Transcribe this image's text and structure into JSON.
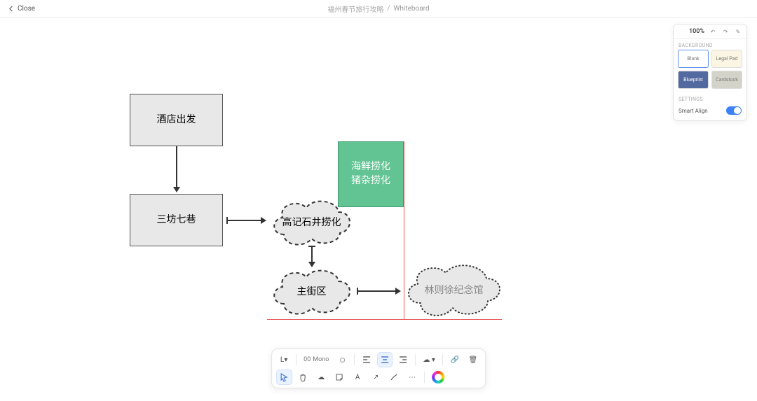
{
  "header": {
    "close": "Close",
    "doc_title": "福州春节旅行攻略",
    "page_name": "Whiteboard"
  },
  "shapes": {
    "hotel": "酒店出发",
    "sanfang": "三坊七巷",
    "seafood_line1": "海鲜捞化",
    "seafood_line2": "猪杂捞化",
    "gaoji": "高记石井捞化",
    "mainstreet": "主街区",
    "linzexu": "林则徐纪念馆"
  },
  "panel": {
    "zoom": "100%",
    "bg_label": "BACKGROUND",
    "bg_blank": "Blank",
    "bg_legal": "Legal Pad",
    "bg_blueprint": "Blueprint",
    "bg_cardstock": "Cardstock",
    "settings_label": "SETTINGS",
    "smart_align": "Smart Align"
  },
  "toolbar": {
    "size": "L",
    "stroke_style": "00",
    "mono": "Mono"
  }
}
